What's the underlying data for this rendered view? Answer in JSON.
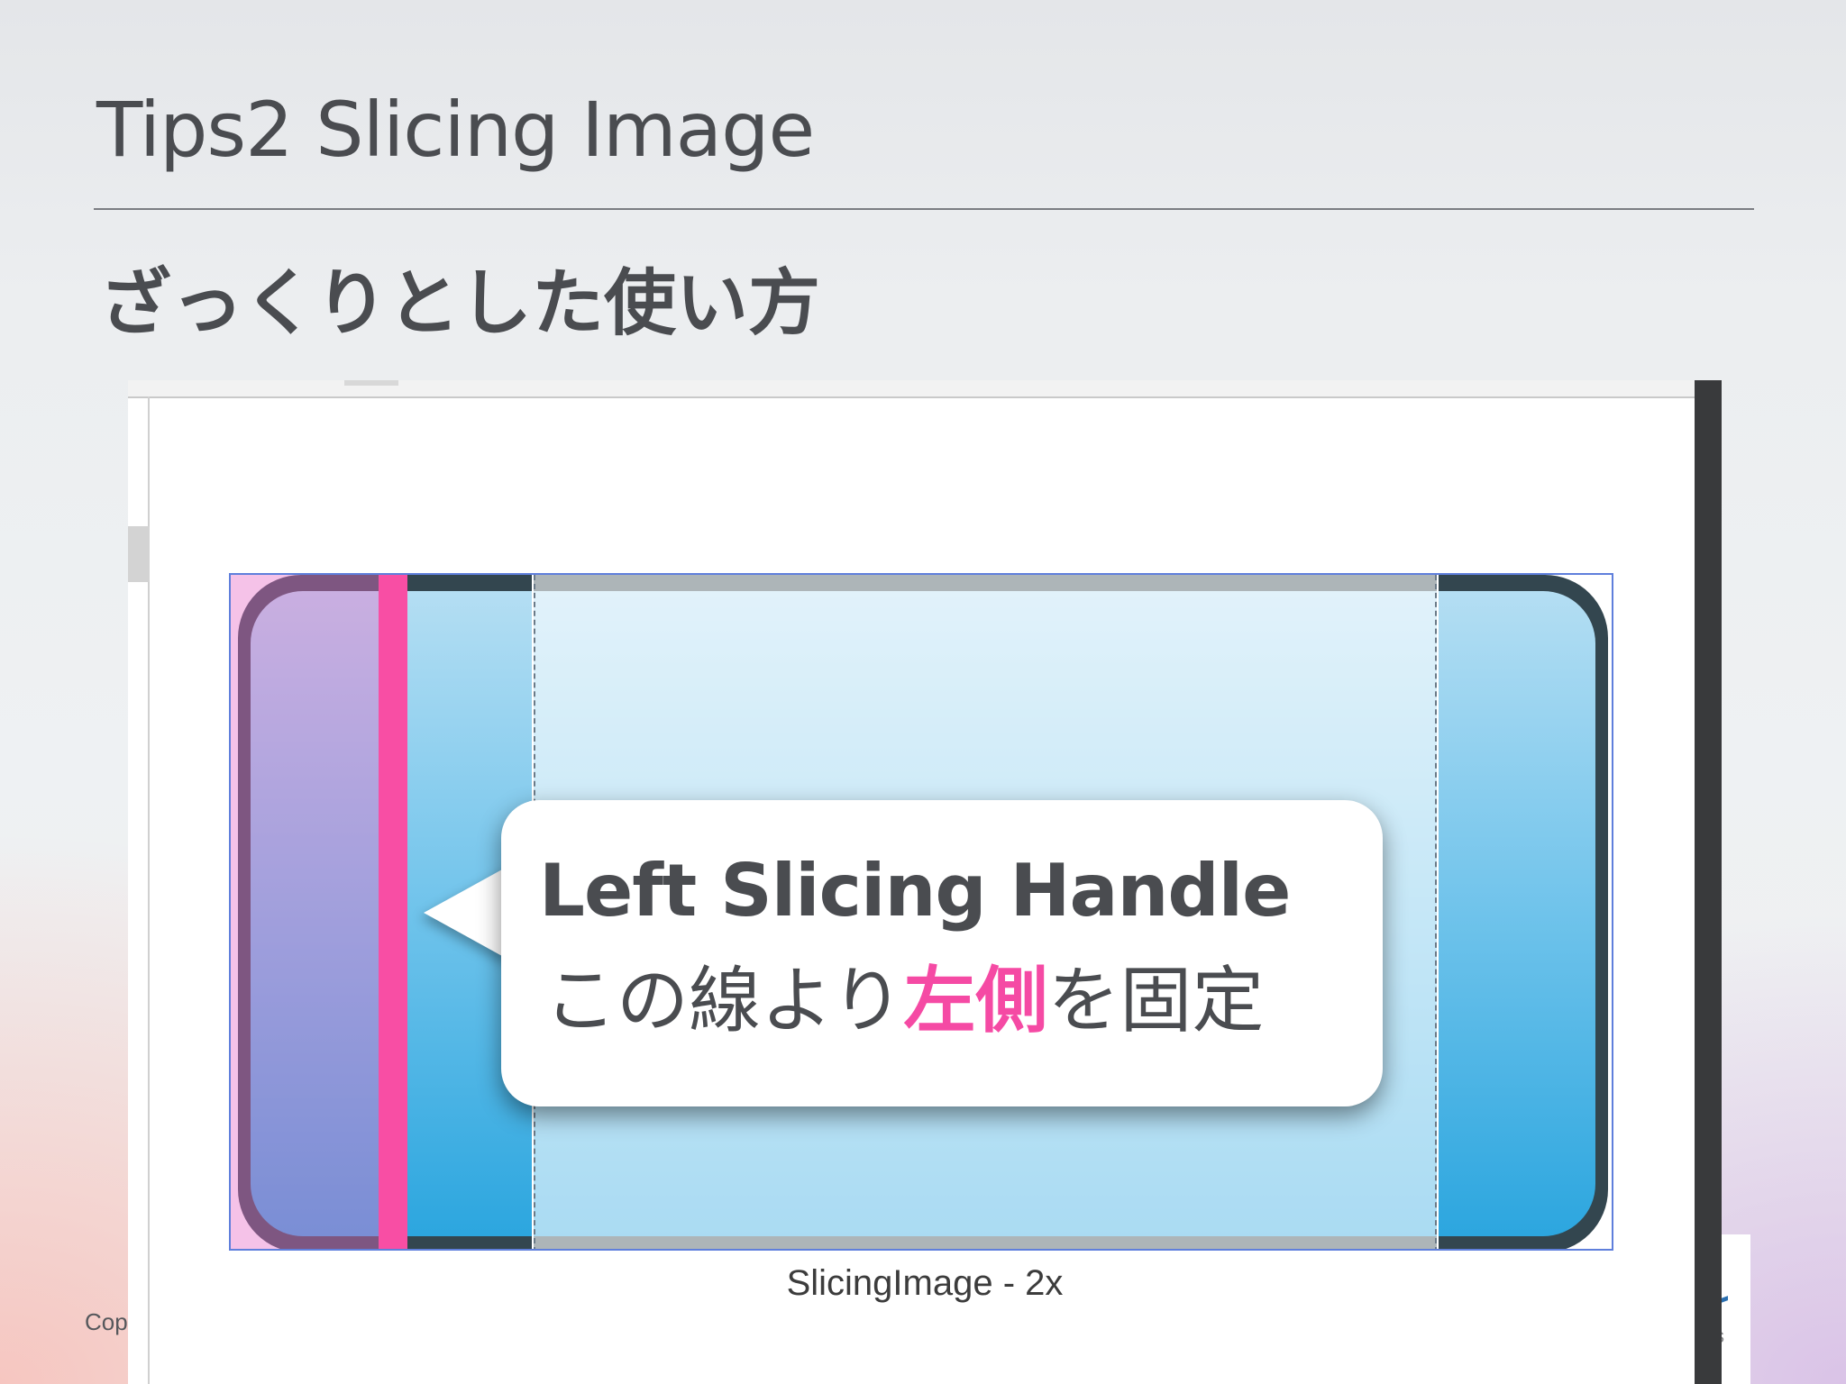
{
  "slide": {
    "title_prefix": "Tips2",
    "title_main": " Slicing Image",
    "subtitle": "ざっくりとした使い方",
    "footer_copyright": "Cop",
    "right_logo_text": "s"
  },
  "screenshot": {
    "caption": "SlicingImage - 2x"
  },
  "callout": {
    "title": "Left Slicing Handle",
    "body_before": "この線より",
    "body_highlight": "左側",
    "body_after": "を固定"
  },
  "colors": {
    "accent_pink": "#f84ea4",
    "text": "#4a4c50",
    "slice_border": "#5f7fdc"
  }
}
